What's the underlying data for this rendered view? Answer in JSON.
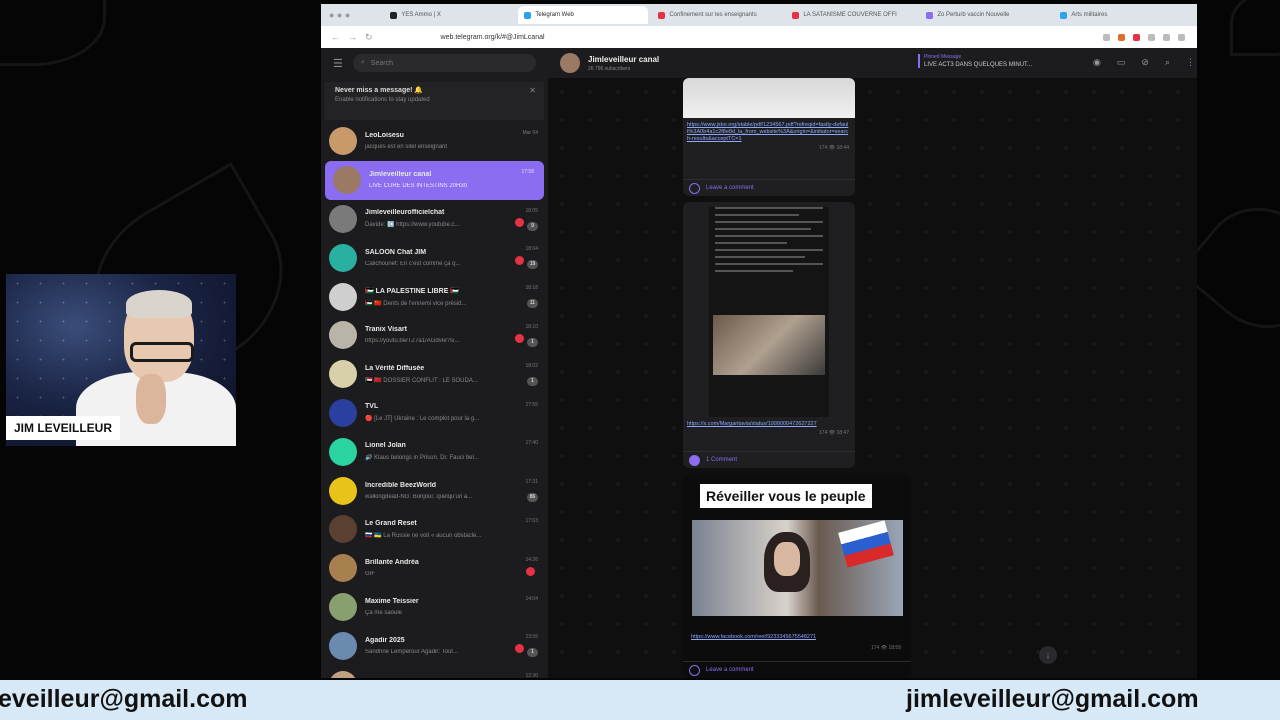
{
  "webcam": {
    "label": "JIM LEVEILLEUR"
  },
  "banner": {
    "email_left": "eveilleur@gmail.com",
    "email_right": "jimleveilleur@gmail.com"
  },
  "browser": {
    "tabs": [
      {
        "label": "YES Ammo | X",
        "color": "#222222",
        "active": false
      },
      {
        "label": "Telegram Web",
        "color": "#2aa3ef",
        "active": true
      },
      {
        "label": "Confinement sur les enseignants",
        "color": "#e53245",
        "active": false
      },
      {
        "label": "LA SATANISME COUVERNE OFFI",
        "color": "#e53245",
        "active": false
      },
      {
        "label": "Zo Perturb vaccin Nouvelle",
        "color": "#8a6df0",
        "active": false
      },
      {
        "label": "Arts militaires",
        "color": "#2aa3ef",
        "active": false
      }
    ],
    "url": "web.telegram.org/k/#@JimLcanal"
  },
  "sidebar": {
    "search_placeholder": "Search",
    "notify_title": "Never miss a message! 🔔",
    "notify_sub": "Enable notifications to stay updated",
    "chats": [
      {
        "name": "LeoLoisesu",
        "preview": "jacques est en sitel enseignant",
        "time": "Mar 04",
        "badge": "",
        "mention": false,
        "color": "#c89a6a",
        "active": false
      },
      {
        "name": "Jimleveilleur canal",
        "preview": "LIVE CURE DES INTESTINS 20H30",
        "time": "17:58",
        "badge": "",
        "mention": false,
        "color": "#9a7a64",
        "active": true
      },
      {
        "name": "Jimleveilleurofficielchat",
        "preview": "Davide: 🆗 https://www.youtube.c...",
        "time": "18:05",
        "badge": "9",
        "mention": true,
        "color": "#7a7a7a",
        "active": false
      },
      {
        "name": "SALOON Chat JIM",
        "preview": "Calichounet: En c'est comme ça q...",
        "time": "18:04",
        "badge": "19",
        "mention": true,
        "color": "#2ab0a0",
        "active": false
      },
      {
        "name": "🇵🇸 LA PALESTINE LIBRE 🇵🇸",
        "preview": "🇵🇸 🇨🇳 Dents de l'ennemi vice présid...",
        "time": "18:18",
        "badge": "11",
        "mention": false,
        "color": "#cfcfcf",
        "active": false
      },
      {
        "name": "Tranix Visart",
        "preview": "https://youtu.be/TZ7a1/AGdvIe?si...",
        "time": "18:10",
        "badge": "1",
        "mention": true,
        "color": "#b8b4a8",
        "active": false
      },
      {
        "name": "La Vérité Diffusée",
        "preview": "🇸🇩 🇲🇦 DOSSIER CONFLIT : LE SOUDA...",
        "time": "18:02",
        "badge": "1",
        "mention": false,
        "color": "#d8d0a8",
        "active": false
      },
      {
        "name": "TVL",
        "preview": "🔴 [Le JT] Ukraine : Le complot pour la g...",
        "time": "17:55",
        "badge": "",
        "mention": false,
        "color": "#2a3fa0",
        "active": false
      },
      {
        "name": "Lionel Jolan",
        "preview": "🔊 Klaus belongs in Prison. Dr. Fauci bel...",
        "time": "17:40",
        "badge": "",
        "mention": false,
        "color": "#2ad3a0",
        "active": false
      },
      {
        "name": "Incredible BeezWorld",
        "preview": "walkingdead-NG: Bonjour, quelqu'un a...",
        "time": "17:31",
        "badge": "86",
        "mention": false,
        "color": "#e8c41a",
        "active": false
      },
      {
        "name": "Le Grand Reset",
        "preview": "🇷🇺 🇺🇦 La Russie ne voit « aucun obstacle...",
        "time": "17:03",
        "badge": "",
        "mention": false,
        "color": "#5a4030",
        "active": false
      },
      {
        "name": "Brillante Andréa",
        "preview": "GIF",
        "time": "14:26",
        "badge": "",
        "mention": true,
        "color": "#a88050",
        "active": false
      },
      {
        "name": "Maxime Teissier",
        "preview": "Ça me saoule",
        "time": "14:04",
        "badge": "",
        "mention": false,
        "color": "#88a070",
        "active": false
      },
      {
        "name": "Agadir 2025",
        "preview": "Sandrine Lemperour Agadir: Tout...",
        "time": "13:55",
        "badge": "1",
        "mention": true,
        "color": "#6a8ab0",
        "active": false
      },
      {
        "name": "JIMLEVEILLEUR SANTE",
        "preview": "",
        "time": "12:30",
        "badge": "",
        "mention": false,
        "color": "#c0a080",
        "active": false
      }
    ]
  },
  "chat": {
    "title": "Jimleveilleur canal",
    "subtitle": "26 796 subscribers",
    "pinned_label": "Pinned Message",
    "pinned_text": "LIVE ACT3 DANS QUELQUES MINUT...",
    "posts": {
      "post1_link": "https://www.jstor.org/stable/pdf/1234567.pdf?refreqid=fastly-default%3A0b4a1c2f8e8d_la_from_website%3A&origin=&initiator=search-results&acceptTC=1",
      "post1_meta": "174 👁 18:44",
      "post2_link": "https://x.com/Margaritavia/status/1999000472627227",
      "post2_meta": "174 👁 18:47",
      "leave_comment": "Leave a comment",
      "one_comment": "1 Comment",
      "post3_title": "Réveiller vous le peuple",
      "post3_link": "https://www.facebook.com/reel/9233345675548271",
      "post3_meta": "174 👁 18:59"
    }
  }
}
